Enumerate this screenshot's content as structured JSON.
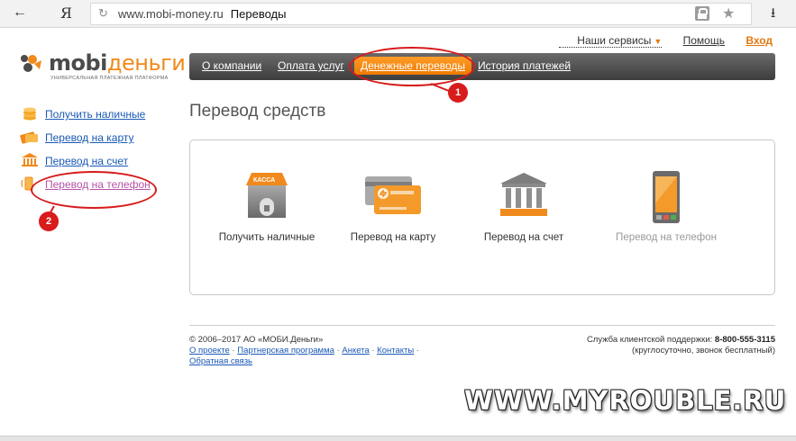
{
  "browser": {
    "back_icon": "←",
    "yandex_label": "Я",
    "reload_icon": "↻",
    "url": "www.mobi-money.ru",
    "title": "Переводы",
    "star_icon": "★",
    "download_icon": "⭳"
  },
  "toplinks": {
    "services": "Наши сервисы",
    "help": "Помощь",
    "login": "Вход"
  },
  "logo": {
    "mobi": "mobi",
    "dengi": "деньги",
    "subtitle": "УНИВЕРСАЛЬНАЯ ПЛАТЕЖНАЯ ПЛАТФОРМА"
  },
  "nav": {
    "items": [
      {
        "label": "О компании"
      },
      {
        "label": "Оплата услуг"
      },
      {
        "label": "Денежные переводы",
        "active": true
      },
      {
        "label": "История платежей"
      }
    ]
  },
  "annotations": {
    "badge1": "1",
    "badge2": "2"
  },
  "sidebar": {
    "items": [
      {
        "label": "Получить наличные",
        "icon": "coins-icon"
      },
      {
        "label": "Перевод на карту",
        "icon": "card-icon"
      },
      {
        "label": "Перевод на счет",
        "icon": "bank-icon"
      },
      {
        "label": "Перевод на телефон",
        "icon": "phone-icon"
      }
    ]
  },
  "main": {
    "title": "Перевод средств",
    "tiles": [
      {
        "label": "Получить наличные",
        "icon": "kassa-icon",
        "icon_text": "КАССА"
      },
      {
        "label": "Перевод на карту",
        "icon": "card-icon"
      },
      {
        "label": "Перевод на счет",
        "icon": "bank-icon"
      },
      {
        "label": "Перевод на телефон",
        "icon": "phone-icon",
        "disabled": true
      }
    ]
  },
  "footer": {
    "copyright": "© 2006–2017 АО «МОБИ.Деньги»",
    "links": [
      "О проекте",
      "Партнерская программа",
      "Анкета",
      "Контакты"
    ],
    "feedback": "Обратная связь",
    "support_label": "Служба клиентской поддержки:",
    "support_phone": "8-800-555-3115",
    "support_note": "(круглосуточно, звонок бесплатный)"
  },
  "watermark": "WWW.MYROUBLE.RU",
  "colors": {
    "accent": "#f08a1c",
    "link": "#1a59b6",
    "visited": "#b552a6",
    "annotation": "#d81b1b",
    "nav_bg": "#4a4a4a"
  }
}
